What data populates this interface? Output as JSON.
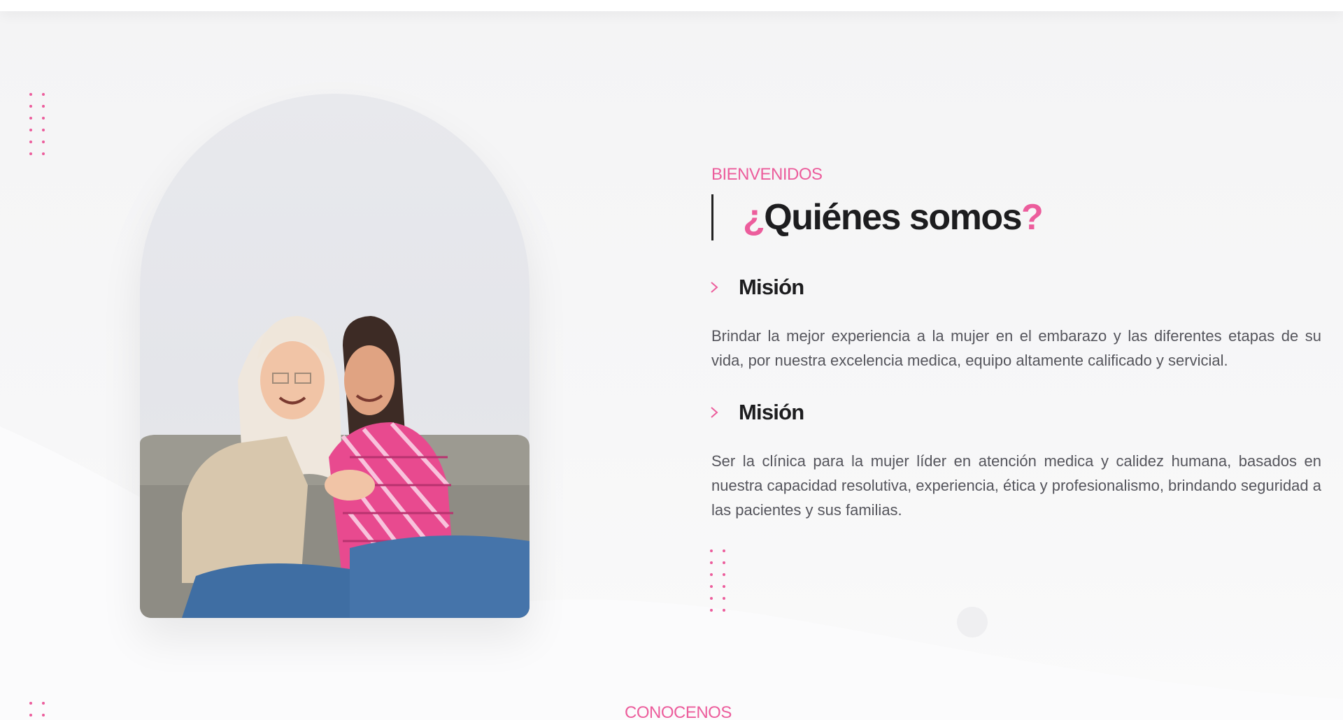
{
  "colors": {
    "accent": "#ec5d9c",
    "heading": "#1d1d1f",
    "body_text": "#55555c"
  },
  "about": {
    "eyebrow": "BIENVENIDOS",
    "title_open": "¿",
    "title_main": "Quiénes somos",
    "title_close": "?",
    "items": [
      {
        "icon": "chevron-right-icon",
        "title": "Misión",
        "text": "Brindar la mejor experiencia a la mujer en el embarazo y las diferentes etapas de su vida, por nuestra excelencia medica, equipo altamente calificado y servicial."
      },
      {
        "icon": "chevron-right-icon",
        "title": "Misión",
        "text": "Ser la clínica para la mujer líder en atención medica y calidez humana, basados en nuestra capacidad resolutiva, experiencia, ética y profesionalismo, brindando seguridad a las pacientes y sus familias."
      }
    ]
  },
  "next_section": {
    "eyebrow": "CONOCENOS"
  }
}
